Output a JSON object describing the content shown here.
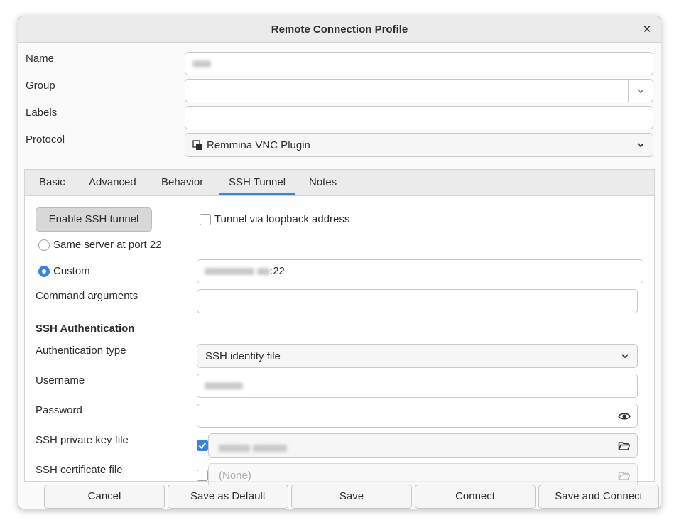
{
  "window": {
    "title": "Remote Connection Profile"
  },
  "form": {
    "name_label": "Name",
    "group_label": "Group",
    "labels_label": "Labels",
    "protocol_label": "Protocol",
    "protocol_value": "Remmina VNC Plugin"
  },
  "tabs": [
    {
      "label": "Basic"
    },
    {
      "label": "Advanced"
    },
    {
      "label": "Behavior"
    },
    {
      "label": "SSH Tunnel",
      "active": true
    },
    {
      "label": "Notes"
    }
  ],
  "ssh": {
    "enable_button": "Enable SSH tunnel",
    "loopback_label": "Tunnel via loopback address",
    "same_server_label": "Same server at port 22",
    "custom_label": "Custom",
    "custom_port_suffix": ":22",
    "command_args_label": "Command arguments",
    "auth_section_title": "SSH Authentication",
    "auth_type_label": "Authentication type",
    "auth_type_value": "SSH identity file",
    "username_label": "Username",
    "password_label": "Password",
    "private_key_label": "SSH private key file",
    "certificate_label": "SSH certificate file",
    "certificate_value": "(None)"
  },
  "footer": {
    "cancel": "Cancel",
    "save_default": "Save as Default",
    "save": "Save",
    "connect": "Connect",
    "save_connect": "Save and Connect"
  },
  "colors": {
    "accent": "#3584e4"
  }
}
